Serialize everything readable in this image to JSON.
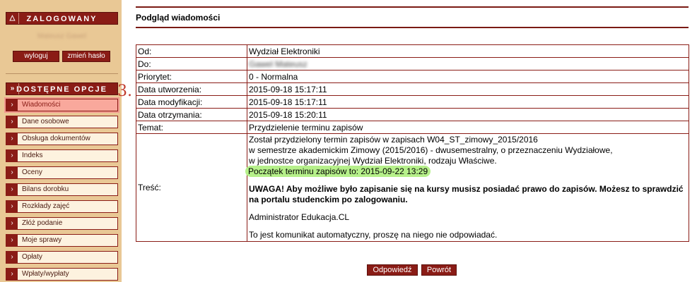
{
  "sidebar": {
    "logged_in_header": "ZALOGOWANY",
    "user_name": "Mateusz Gawel",
    "logout_label": "wyloguj",
    "change_password_label": "zmień hasło",
    "options_header": "DOSTĘPNE OPCJE",
    "step_number": "3.",
    "menu": [
      {
        "label": "Wiadomości",
        "active": true
      },
      {
        "label": "Dane osobowe"
      },
      {
        "label": "Obsługa dokumentów"
      },
      {
        "label": "Indeks"
      },
      {
        "label": "Oceny"
      },
      {
        "label": "Bilans dorobku"
      },
      {
        "label": "Rozkłady zajęć"
      },
      {
        "label": "Złóż podanie"
      },
      {
        "label": "Moje sprawy"
      },
      {
        "label": "Opłaty"
      },
      {
        "label": "Wpłaty/wypłaty"
      }
    ]
  },
  "main": {
    "title": "Podgląd wiadomości",
    "fields": {
      "from_label": "Od:",
      "from_value": "Wydział Elektroniki",
      "to_label": "Do:",
      "to_value": "Gawel Mateusz",
      "priority_label": "Priorytet:",
      "priority_value": "0 - Normalna",
      "created_label": "Data utworzenia:",
      "created_value": "2015-09-18 15:17:11",
      "modified_label": "Data modyfikacji:",
      "modified_value": "2015-09-18 15:17:11",
      "received_label": "Data otrzymania:",
      "received_value": "2015-09-18 15:20:11",
      "subject_label": "Temat:",
      "subject_value": "Przydzielenie terminu zapisów",
      "content_label": "Treść:"
    },
    "content": {
      "line1": "Został przydzielony termin zapisów w zapisach W04_ST_zimowy_2015/2016",
      "line2": "w semestrze akademickim Zimowy (2015/2016) - dwusemestralny, o przeznaczeniu Wydziałowe,",
      "line3": "w jednostce organizacyjnej Wydział Elektroniki, rodzaju Właściwe.",
      "line4": "Początek terminu zapisów to: 2015-09-22 13:29",
      "warning": "UWAGA! Aby możliwe było zapisanie się na kursy musisz posiadać prawo do zapisów. Możesz to sprawdzić na portalu studenckim po zalogowaniu.",
      "signature": "Administrator Edukacja.CL",
      "auto_note": "To jest komunikat automatyczny, proszę na niego nie odpowiadać."
    },
    "reply_label": "Odpowiedź",
    "back_label": "Powrót"
  },
  "colors": {
    "accent": "#8a1c16",
    "sidebar_bg": "#e9c895",
    "highlight": "#b6f08a"
  }
}
